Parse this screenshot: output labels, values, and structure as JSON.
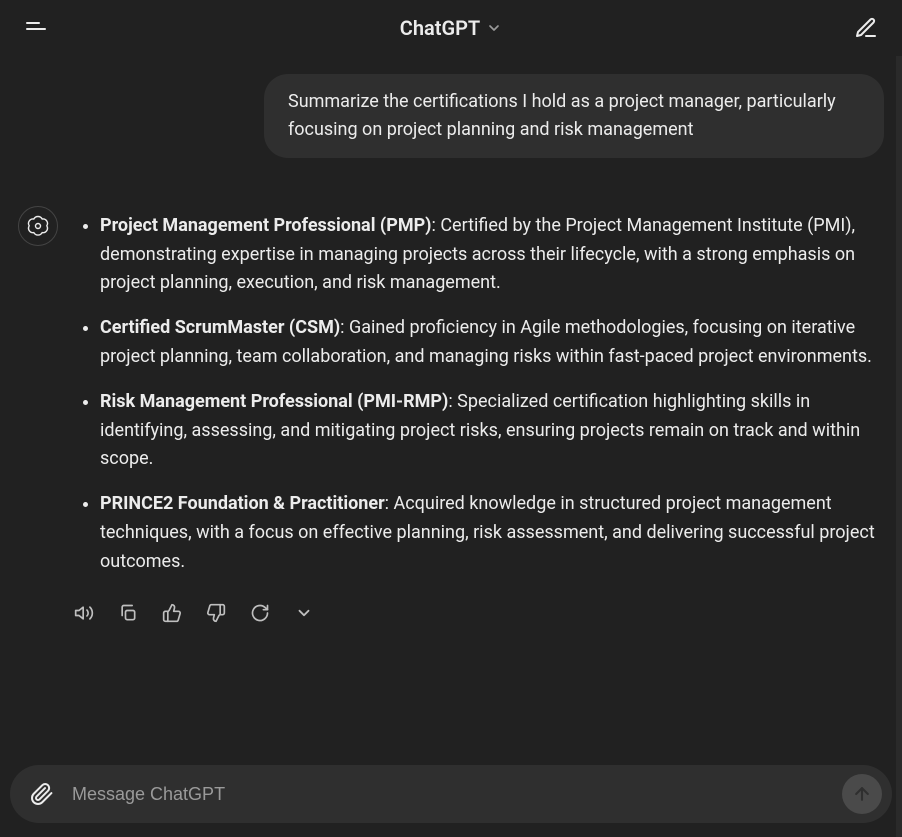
{
  "header": {
    "title": "ChatGPT"
  },
  "user_message": "Summarize the certifications I hold as a project manager, particularly focusing on project planning and risk management",
  "assistant_items": [
    {
      "title": "Project Management Professional (PMP)",
      "desc": ": Certified by the Project Management Institute (PMI), demonstrating expertise in managing projects across their lifecycle, with a strong emphasis on project planning, execution, and risk management."
    },
    {
      "title": "Certified ScrumMaster (CSM)",
      "desc": ": Gained proficiency in Agile methodologies, focusing on iterative project planning, team collaboration, and managing risks within fast-paced project environments."
    },
    {
      "title": "Risk Management Professional (PMI-RMP)",
      "desc": ": Specialized certification highlighting skills in identifying, assessing, and mitigating project risks, ensuring projects remain on track and within scope."
    },
    {
      "title": "PRINCE2 Foundation & Practitioner",
      "desc": ": Acquired knowledge in structured project management techniques, with a focus on effective planning, risk assessment, and delivering successful project outcomes."
    }
  ],
  "input": {
    "placeholder": "Message ChatGPT"
  }
}
